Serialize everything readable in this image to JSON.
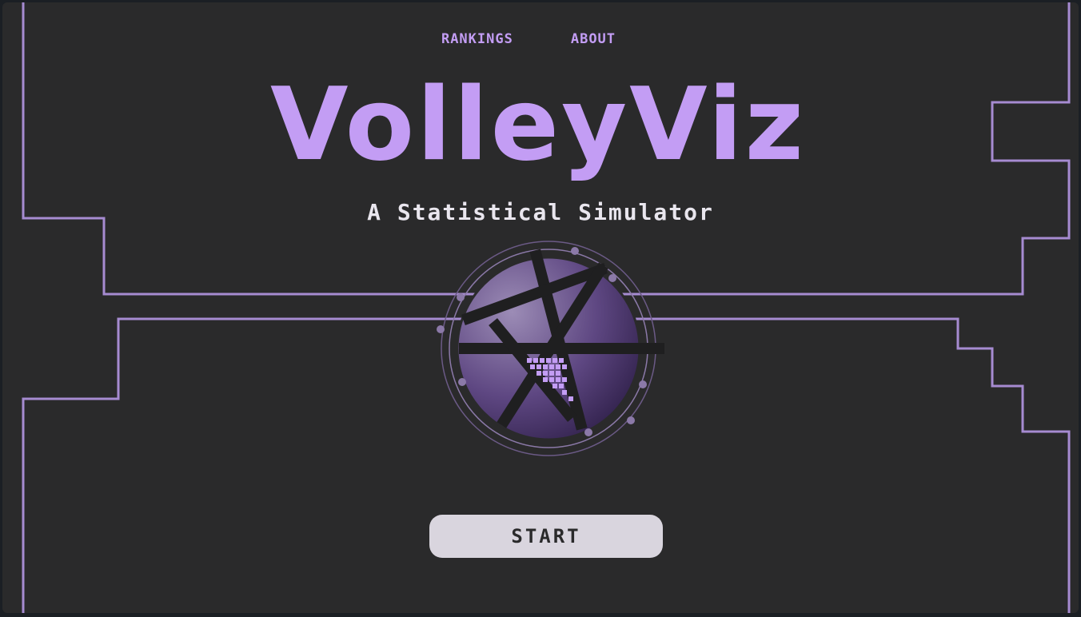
{
  "nav": {
    "rankings": "RANKINGS",
    "about": "ABOUT"
  },
  "hero": {
    "title": "VolleyViz",
    "subtitle": "A Statistical Simulator"
  },
  "actions": {
    "start_label": "START"
  },
  "colors": {
    "accent": "#c39df4",
    "line": "#a68bd1",
    "background": "#2a2a2b",
    "button_bg": "#d9d5de"
  },
  "icons": {
    "logo": "volleyball-emblem-icon"
  }
}
